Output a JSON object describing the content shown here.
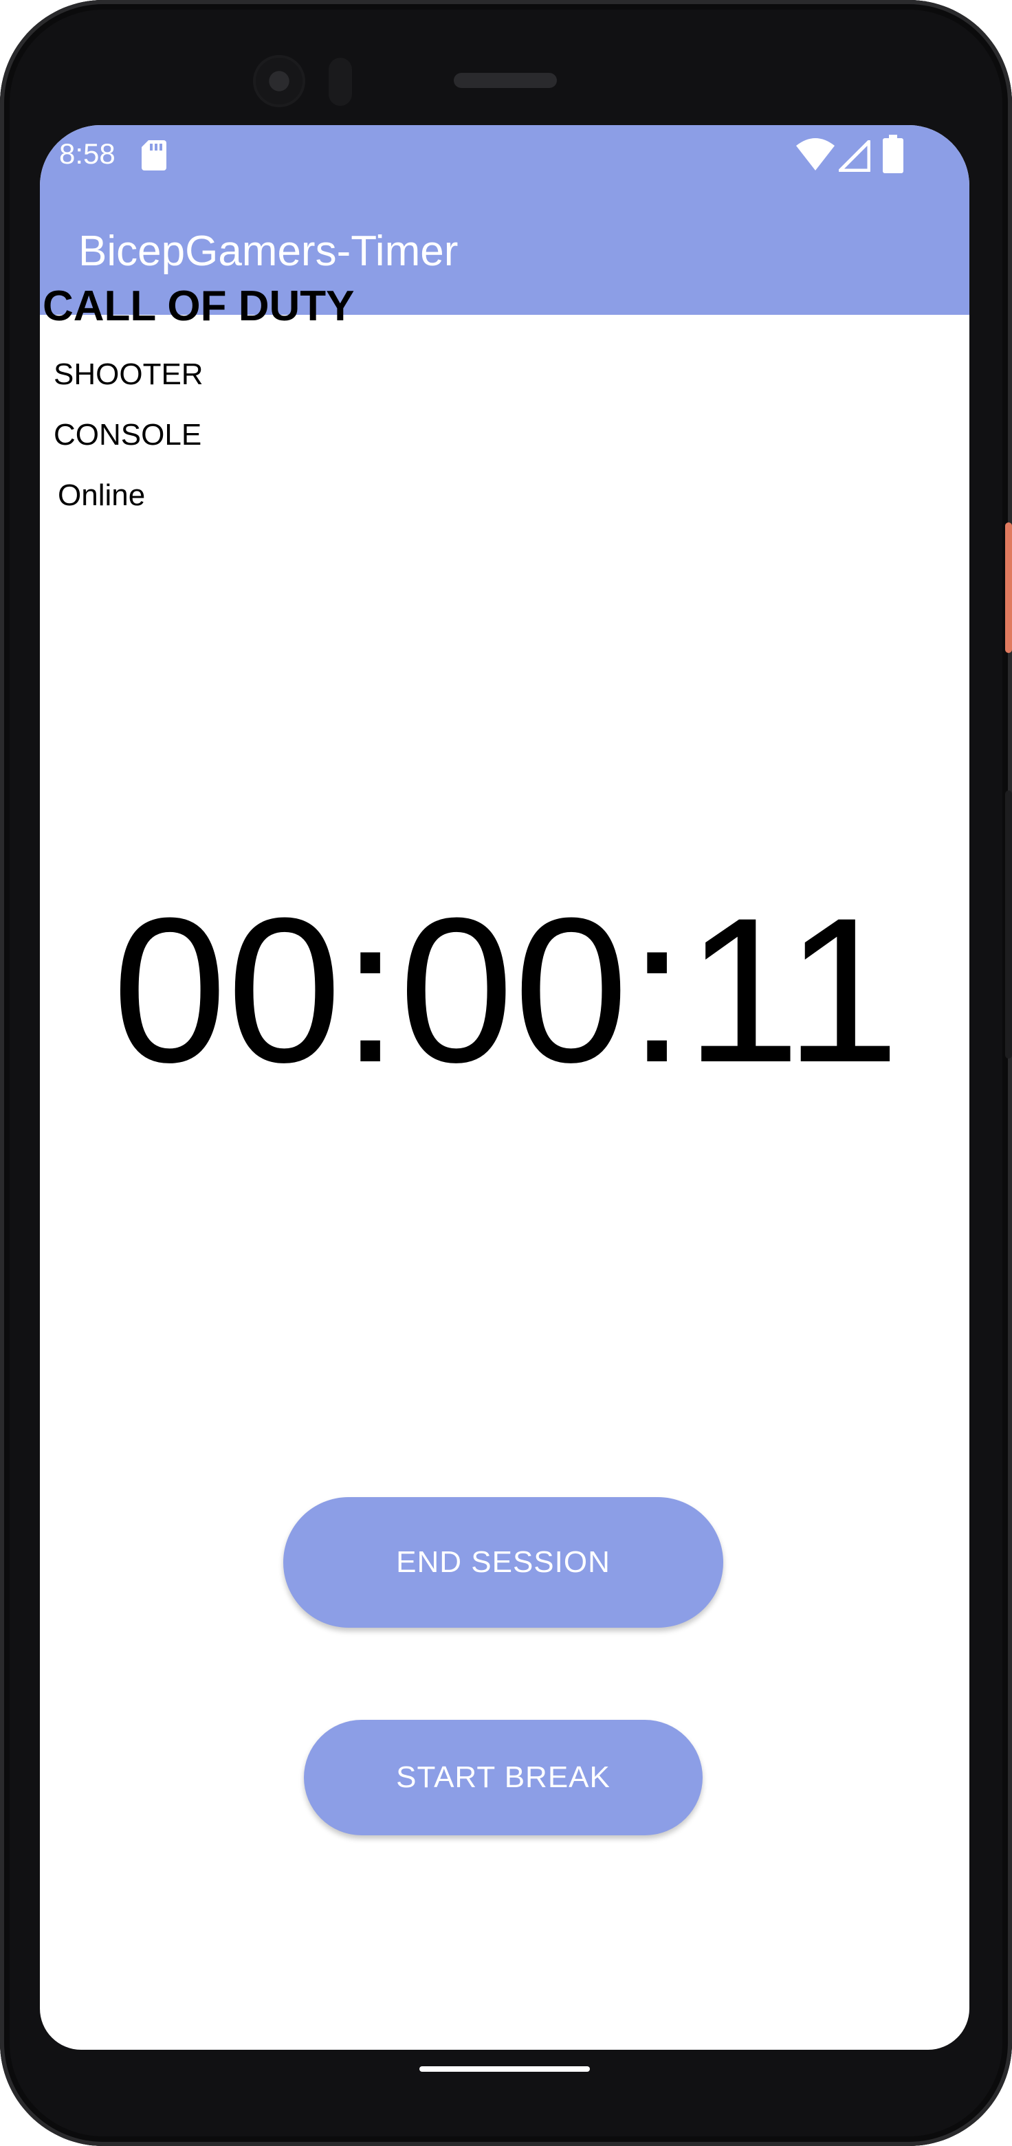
{
  "status_bar": {
    "time": "8:58"
  },
  "app_bar": {
    "title": "BicepGamers-Timer"
  },
  "game": {
    "title": "CALL OF DUTY",
    "genre": "SHOOTER",
    "platform": "CONSOLE",
    "mode": "Online"
  },
  "timer": {
    "value": "00:00:11"
  },
  "buttons": {
    "end_session": "END SESSION",
    "start_break": "START BREAK"
  },
  "colors": {
    "accent": "#8c9ee6",
    "side_button": "#e07a5f"
  }
}
